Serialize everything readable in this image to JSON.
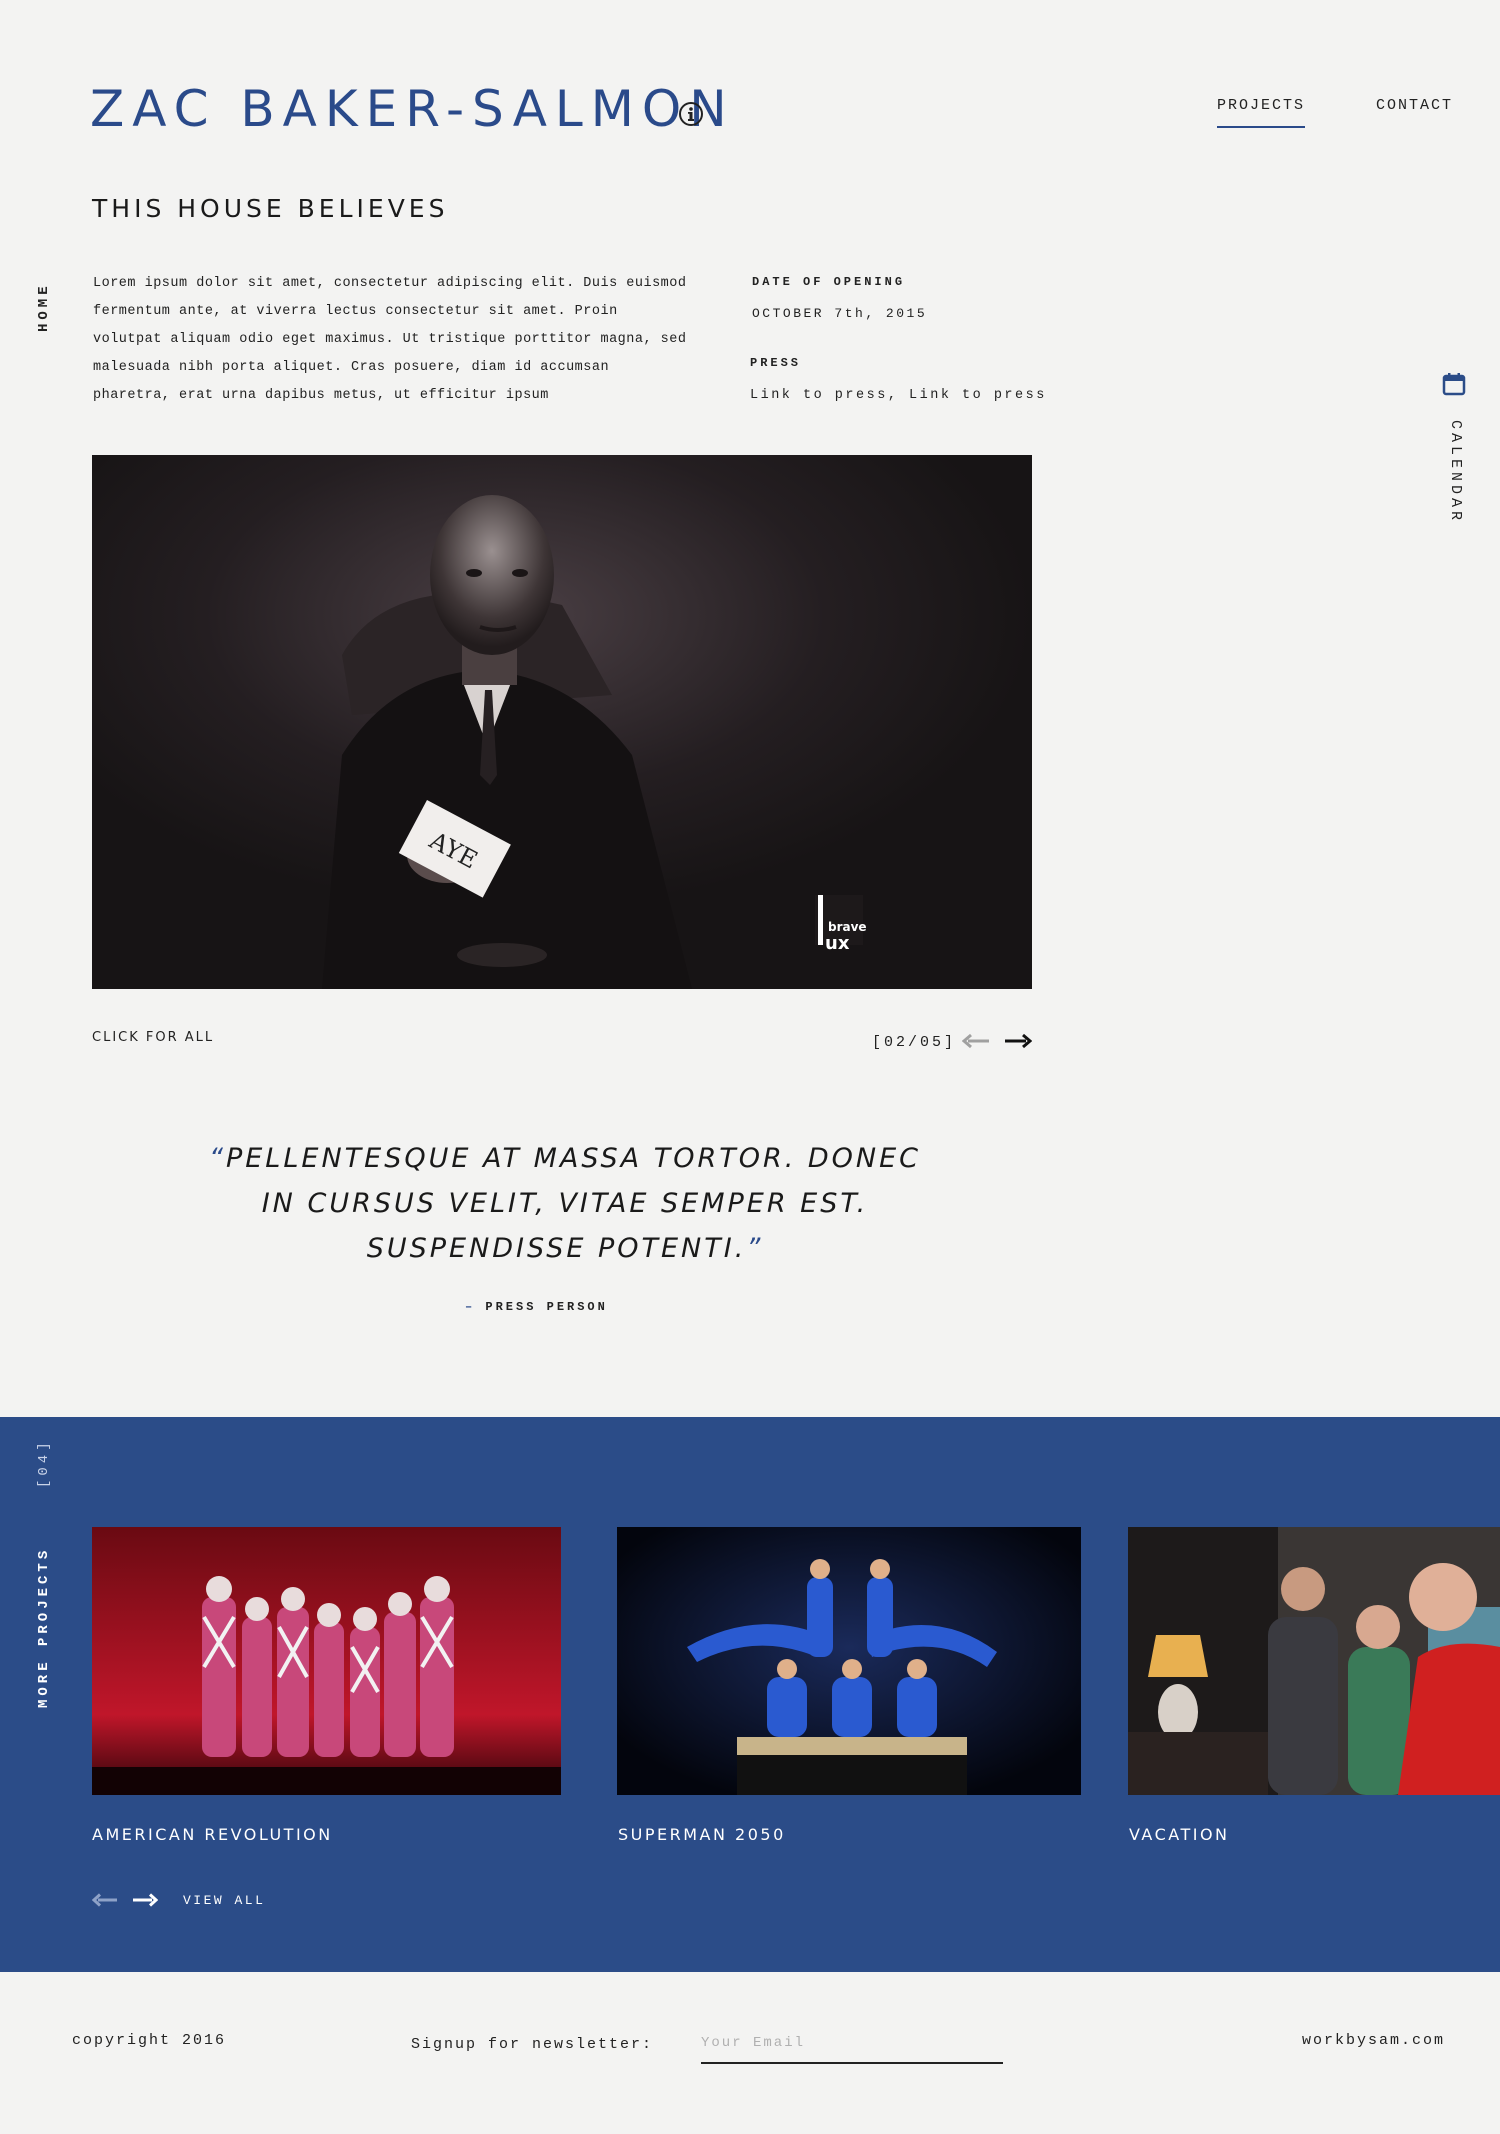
{
  "header": {
    "site_title": "ZAC BAKER-SALMON",
    "nav": [
      {
        "label": "PROJECTS",
        "active": true
      },
      {
        "label": "CONTACT",
        "active": false
      }
    ]
  },
  "side": {
    "home_label": "HOME",
    "calendar_label": "CALENDAR"
  },
  "project": {
    "title": "THIS HOUSE BELIEVES",
    "description": "Lorem ipsum dolor sit amet, consectetur adipiscing elit. Duis euismod fermentum ante, at viverra lectus consectetur sit amet. Proin volutpat aliquam odio eget maximus. Ut tristique porttitor magna, sed malesuada nibh porta aliquet. Cras posuere, diam id accumsan pharetra, erat urna dapibus metus, ut efficitur ipsum",
    "date_heading": "DATE OF OPENING",
    "date_value": "OCTOBER 7th, 2015",
    "press_heading": "PRESS",
    "press_links": "Link to press, Link to press"
  },
  "gallery": {
    "hero_card_text": "AYE",
    "hero_logo_text": "brave lux",
    "click_all": "CLICK FOR ALL",
    "counter": "[02/05]"
  },
  "quote": {
    "open_mark": "“",
    "text": "PELLENTESQUE AT MASSA TORTOR. DONEC IN CURSUS VELIT, VITAE SEMPER EST. SUSPENDISSE POTENTI.",
    "close_mark": "”",
    "dash": "–",
    "attribution": "PRESS PERSON"
  },
  "more_projects": {
    "label": "MORE PROJECTS",
    "count": "[04]",
    "items": [
      {
        "title": "AMERICAN REVOLUTION"
      },
      {
        "title": "SUPERMAN 2050"
      },
      {
        "title": "VACATION"
      }
    ],
    "view_all": "VIEW ALL"
  },
  "footer": {
    "copyright": "copyright 2016",
    "newsletter_label": "Signup for newsletter:",
    "email_placeholder": "Your Email",
    "site_link": "workbysam.com"
  },
  "colors": {
    "accent": "#2b4c88",
    "background": "#f3f3f2",
    "text": "#1a1a1a"
  },
  "icons": [
    "info-icon",
    "calendar-icon",
    "arrow-left-icon",
    "arrow-right-icon"
  ]
}
